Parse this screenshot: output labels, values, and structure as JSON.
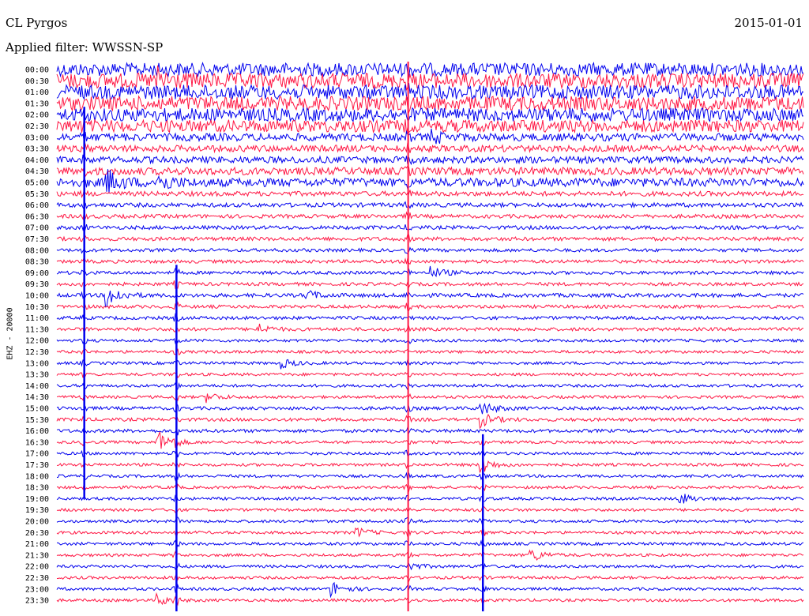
{
  "header": {
    "station": "CL Pyrgos",
    "date": "2015-01-01",
    "filter": "Applied filter: WWSSN-SP"
  },
  "chart_data": {
    "type": "line",
    "title": "CL Pyrgos",
    "subtitle": "Applied filter: WWSSN-SP",
    "ylabel": "EHZ - 20000",
    "xlabel": "",
    "grid": false,
    "trace_minutes": 30,
    "series_colors": [
      "#0000ee",
      "#ff1744"
    ],
    "colors": {
      "trace_a": "#0000ee",
      "trace_b": "#ff1744",
      "background": "#ffffff"
    },
    "ytick_labels": [
      "00:00",
      "00:30",
      "01:00",
      "01:30",
      "02:00",
      "02:30",
      "03:00",
      "03:30",
      "04:00",
      "04:30",
      "05:00",
      "05:30",
      "06:00",
      "06:30",
      "07:00",
      "07:30",
      "08:00",
      "08:30",
      "09:00",
      "09:30",
      "10:00",
      "10:30",
      "11:00",
      "11:30",
      "12:00",
      "12:30",
      "13:00",
      "13:30",
      "14:00",
      "14:30",
      "15:00",
      "15:30",
      "16:00",
      "16:30",
      "17:00",
      "17:30",
      "18:00",
      "18:30",
      "19:00",
      "19:30",
      "20:00",
      "20:30",
      "21:00",
      "21:30",
      "22:00",
      "22:30",
      "23:00",
      "23:30"
    ],
    "noise_level": [
      1.4,
      1.6,
      1.5,
      1.5,
      1.4,
      1.3,
      0.8,
      0.7,
      0.7,
      0.8,
      0.9,
      0.5,
      0.45,
      0.4,
      0.4,
      0.4,
      0.35,
      0.35,
      0.35,
      0.35,
      0.4,
      0.35,
      0.35,
      0.35,
      0.3,
      0.3,
      0.3,
      0.3,
      0.3,
      0.3,
      0.35,
      0.35,
      0.35,
      0.3,
      0.3,
      0.3,
      0.3,
      0.3,
      0.3,
      0.3,
      0.3,
      0.3,
      0.3,
      0.3,
      0.3,
      0.3,
      0.3,
      0.3
    ],
    "events": [
      {
        "trace": 1,
        "minute": 4,
        "amplitude": 2.0
      },
      {
        "trace": 6,
        "minute": 15,
        "amplitude": 1.2
      },
      {
        "trace": 10,
        "minute": 2,
        "amplitude": 2.5
      },
      {
        "trace": 10,
        "minute": 4,
        "amplitude": 2.0
      },
      {
        "trace": 18,
        "minute": 15,
        "amplitude": 1.2
      },
      {
        "trace": 20,
        "minute": 2,
        "amplitude": 2.5
      },
      {
        "trace": 20,
        "minute": 10,
        "amplitude": 1.0
      },
      {
        "trace": 23,
        "minute": 8,
        "amplitude": 1.2
      },
      {
        "trace": 26,
        "minute": 9,
        "amplitude": 1.0
      },
      {
        "trace": 29,
        "minute": 6,
        "amplitude": 1.0
      },
      {
        "trace": 30,
        "minute": 17,
        "amplitude": 1.5
      },
      {
        "trace": 31,
        "minute": 17,
        "amplitude": 1.5
      },
      {
        "trace": 33,
        "minute": 4,
        "amplitude": 2.8
      },
      {
        "trace": 35,
        "minute": 17,
        "amplitude": 1.6
      },
      {
        "trace": 38,
        "minute": 25,
        "amplitude": 1.2
      },
      {
        "trace": 41,
        "minute": 12,
        "amplitude": 1.0
      },
      {
        "trace": 43,
        "minute": 19,
        "amplitude": 1.5
      },
      {
        "trace": 44,
        "minute": 14,
        "amplitude": 1.0
      },
      {
        "trace": 46,
        "minute": 11,
        "amplitude": 1.6
      },
      {
        "trace": 47,
        "minute": 4,
        "amplitude": 1.2
      }
    ],
    "long_pulses": [
      {
        "minute": 1.1,
        "from_trace": 4,
        "to_trace": 37,
        "amplitude": 0.6
      },
      {
        "minute": 4.8,
        "from_trace": 18,
        "to_trace": 47,
        "amplitude": 0.8
      },
      {
        "minute": 14.1,
        "from_trace": 0,
        "to_trace": 47,
        "amplitude": 0.7
      },
      {
        "minute": 17.1,
        "from_trace": 33,
        "to_trace": 47,
        "amplitude": 0.7
      }
    ]
  }
}
